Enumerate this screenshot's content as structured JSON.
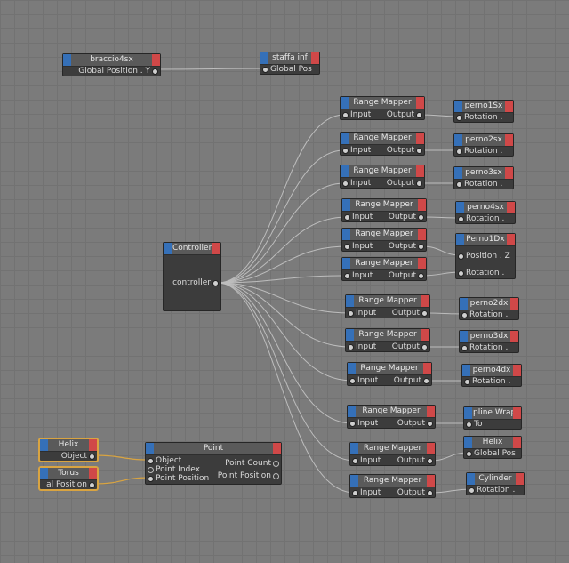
{
  "nodes": {
    "braccio4sx": {
      "title": "braccio4sx",
      "out": "Global Position . Y"
    },
    "staffa_inf": {
      "title": "staffa inf",
      "in": "Global Pos"
    },
    "controller": {
      "title": "Controller",
      "out": "controller"
    },
    "range_mappers": [
      {
        "title": "Range Mapper",
        "in": "Input",
        "out": "Output"
      },
      {
        "title": "Range Mapper",
        "in": "Input",
        "out": "Output"
      },
      {
        "title": "Range Mapper",
        "in": "Input",
        "out": "Output"
      },
      {
        "title": "Range Mapper",
        "in": "Input",
        "out": "Output"
      },
      {
        "title": "Range Mapper",
        "in": "Input",
        "out": "Output"
      },
      {
        "title": "Range Mapper",
        "in": "Input",
        "out": "Output"
      },
      {
        "title": "Range Mapper",
        "in": "Input",
        "out": "Output"
      },
      {
        "title": "Range Mapper",
        "in": "Input",
        "out": "Output"
      },
      {
        "title": "Range Mapper",
        "in": "Input",
        "out": "Output"
      },
      {
        "title": "Range Mapper",
        "in": "Input",
        "out": "Output"
      },
      {
        "title": "Range Mapper",
        "in": "Input",
        "out": "Output"
      },
      {
        "title": "Range Mapper",
        "in": "Input",
        "out": "Output"
      }
    ],
    "targets": [
      {
        "title": "perno1Sx",
        "in": "Rotation ."
      },
      {
        "title": "perno2sx",
        "in": "Rotation ."
      },
      {
        "title": "perno3sx",
        "in": "Rotation ."
      },
      {
        "title": "perno4sx",
        "in": "Rotation ."
      },
      {
        "title": "Perno1Dx",
        "in": "Position . Z",
        "in2": "Rotation ."
      },
      {
        "title": "perno2dx",
        "in": "Rotation ."
      },
      {
        "title": "perno3dx",
        "in": "Rotation ."
      },
      {
        "title": "perno4dx",
        "in": "Rotation ."
      },
      {
        "title": "pline Wrap",
        "in": "To"
      },
      {
        "title": "Helix",
        "in": "Global Pos"
      },
      {
        "title": "Cylinder",
        "in": "Rotation ."
      }
    ],
    "helix_src": {
      "title": "Helix",
      "out": "Object"
    },
    "torus_src": {
      "title": "Torus",
      "out": "al Position"
    },
    "point": {
      "title": "Point",
      "in1": "Object",
      "in2": "Point Index",
      "in3": "Point Position",
      "out1": "Point Count",
      "out2": "Point Position"
    }
  },
  "colors": {
    "wire": "#c9c9c9",
    "selected_wire": "#d9a441",
    "header_left": "#3570b8",
    "header_right": "#d04848"
  }
}
